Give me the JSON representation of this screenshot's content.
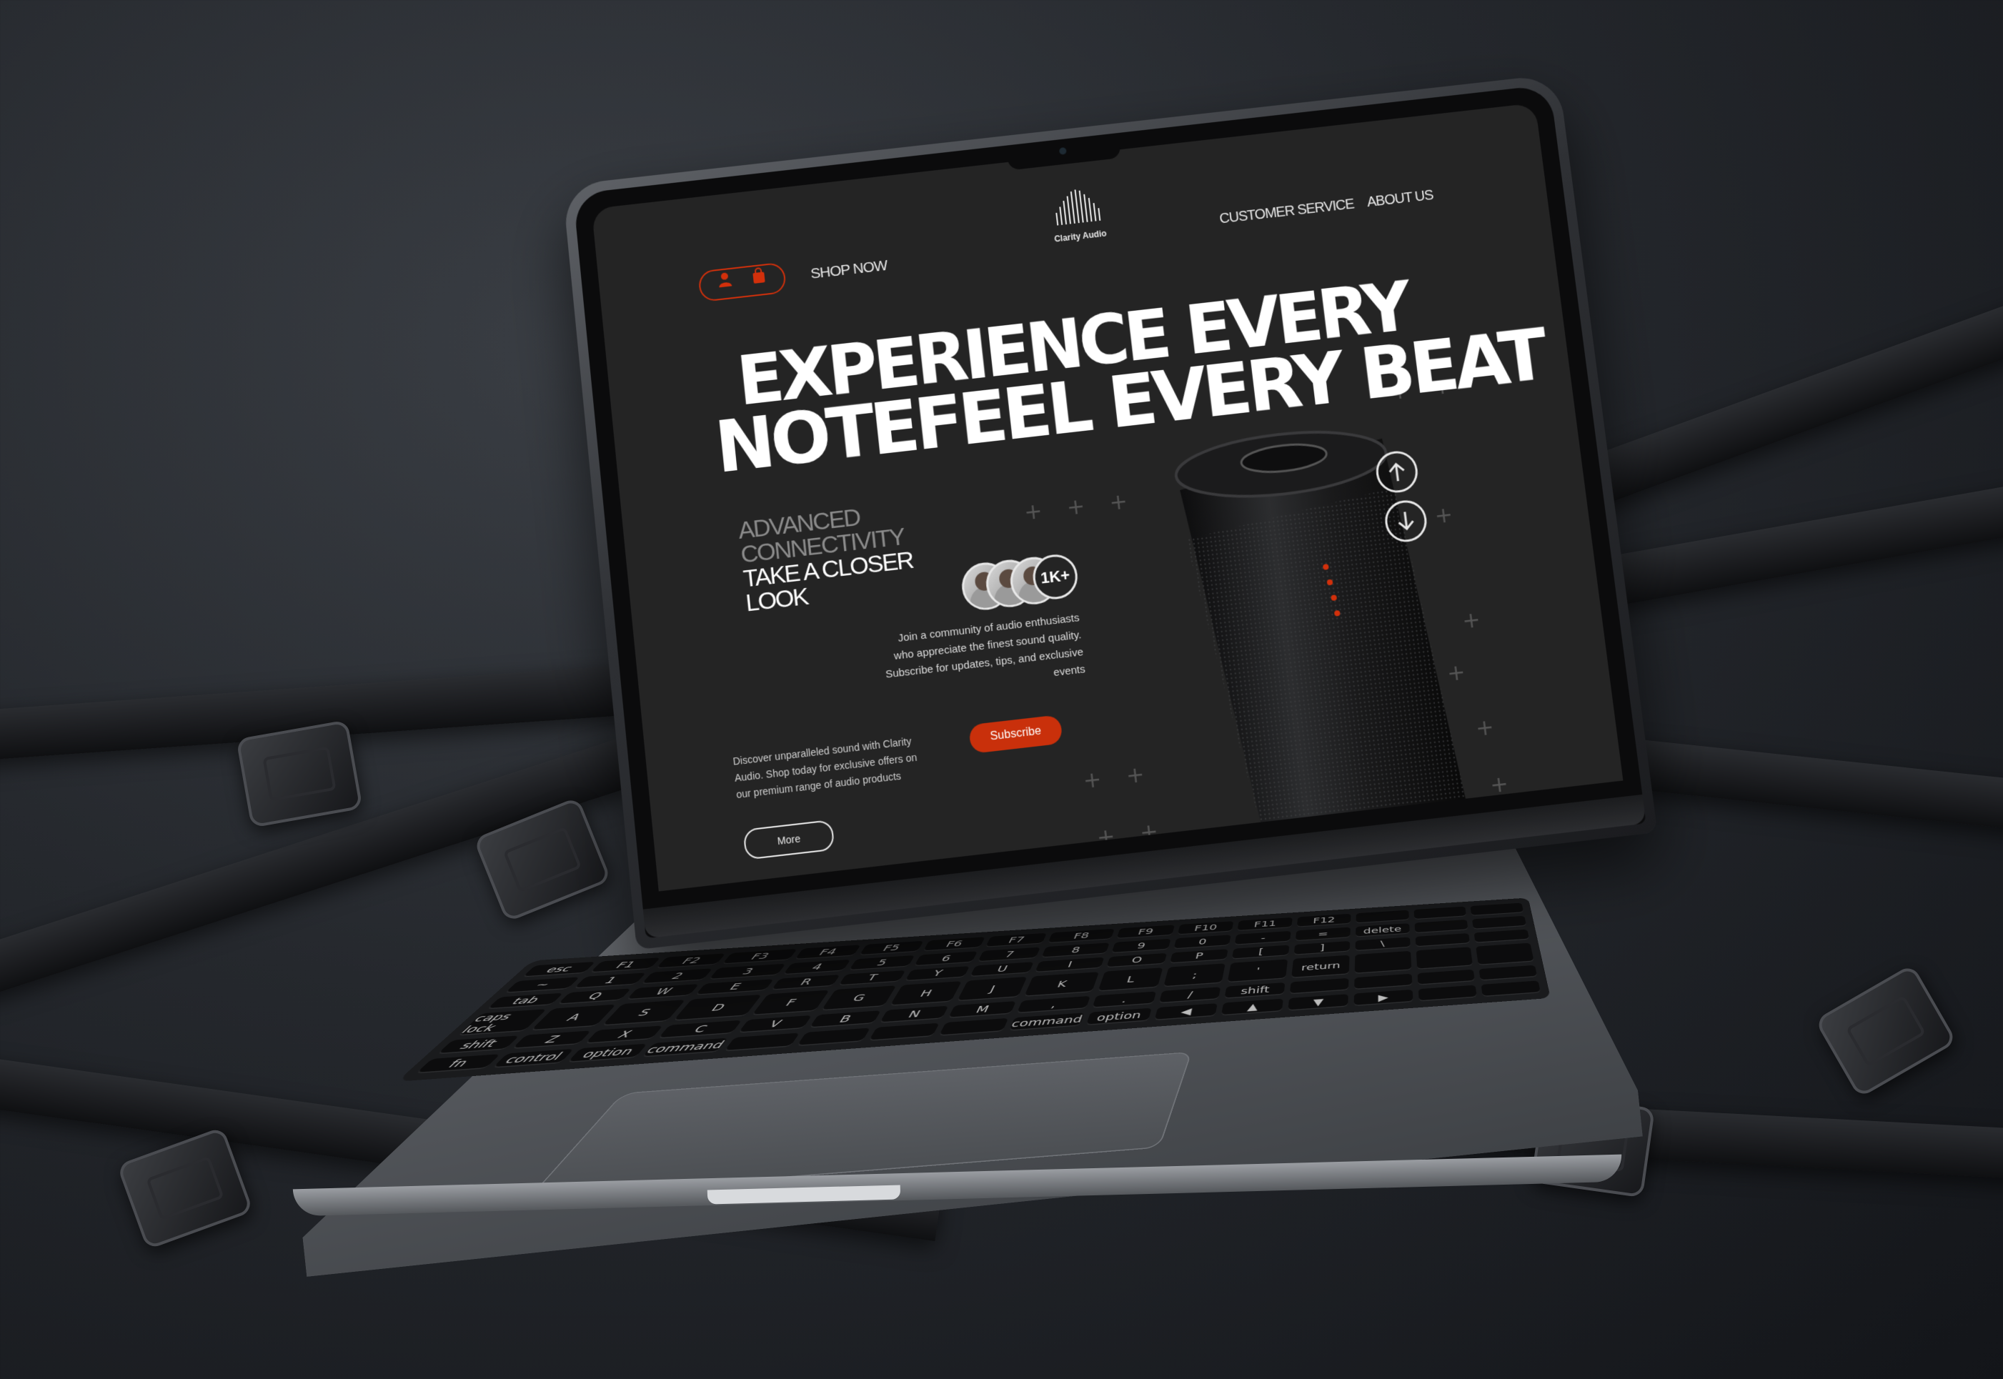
{
  "website": {
    "nav": {
      "shop_label": "SHOP NOW",
      "customer_service_label": "CUSTOMER SERVICE",
      "about_label": "ABOUT US",
      "logo_text": "Clarity Audio"
    },
    "hero": {
      "headline_line1": "EXPERIENCE EVERY",
      "headline_line2": "NOTEFEEL EVERY BEAT",
      "subhead_dim_1": "ADVANCED",
      "subhead_dim_2": "CONNECTIVITY",
      "subhead_bright_1": "TAKE A CLOSER",
      "subhead_bright_2": "LOOK"
    },
    "community": {
      "count_badge": "1K+",
      "text": "Join a community of audio enthusiasts who appreciate the finest sound quality. Subscribe for updates, tips, and exclusive events",
      "subscribe_label": "Subscribe"
    },
    "discover": {
      "text": "Discover unparalleled sound with Clarity Audio. Shop today for exclusive offers on our premium range of audio products",
      "more_label": "More"
    },
    "icons": {
      "user": "user-icon",
      "bag": "bag-icon",
      "up": "arrow-up-icon",
      "down": "arrow-down-icon"
    },
    "colors": {
      "accent": "#c9300b",
      "screen_bg": "#242424"
    }
  },
  "keyboard": {
    "keys": [
      "esc",
      "F1",
      "F2",
      "F3",
      "F4",
      "F5",
      "F6",
      "F7",
      "F8",
      "F9",
      "F10",
      "F11",
      "F12",
      "",
      "",
      "",
      "~",
      "1",
      "2",
      "3",
      "4",
      "5",
      "6",
      "7",
      "8",
      "9",
      "0",
      "-",
      "=",
      "delete",
      "",
      "",
      "tab",
      "Q",
      "W",
      "E",
      "R",
      "T",
      "Y",
      "U",
      "I",
      "O",
      "P",
      "[",
      "]",
      "\\",
      "",
      "",
      "caps lock",
      "A",
      "S",
      "D",
      "F",
      "G",
      "H",
      "J",
      "K",
      "L",
      ";",
      "'",
      "return",
      "",
      "",
      "",
      "shift",
      "Z",
      "X",
      "C",
      "V",
      "B",
      "N",
      "M",
      ",",
      ".",
      "/",
      "shift",
      "",
      "",
      "",
      "",
      "fn",
      "control",
      "option",
      "command",
      "",
      "",
      "",
      "",
      "command",
      "option",
      "◀",
      "▲",
      "▼",
      "▶",
      "",
      ""
    ]
  }
}
